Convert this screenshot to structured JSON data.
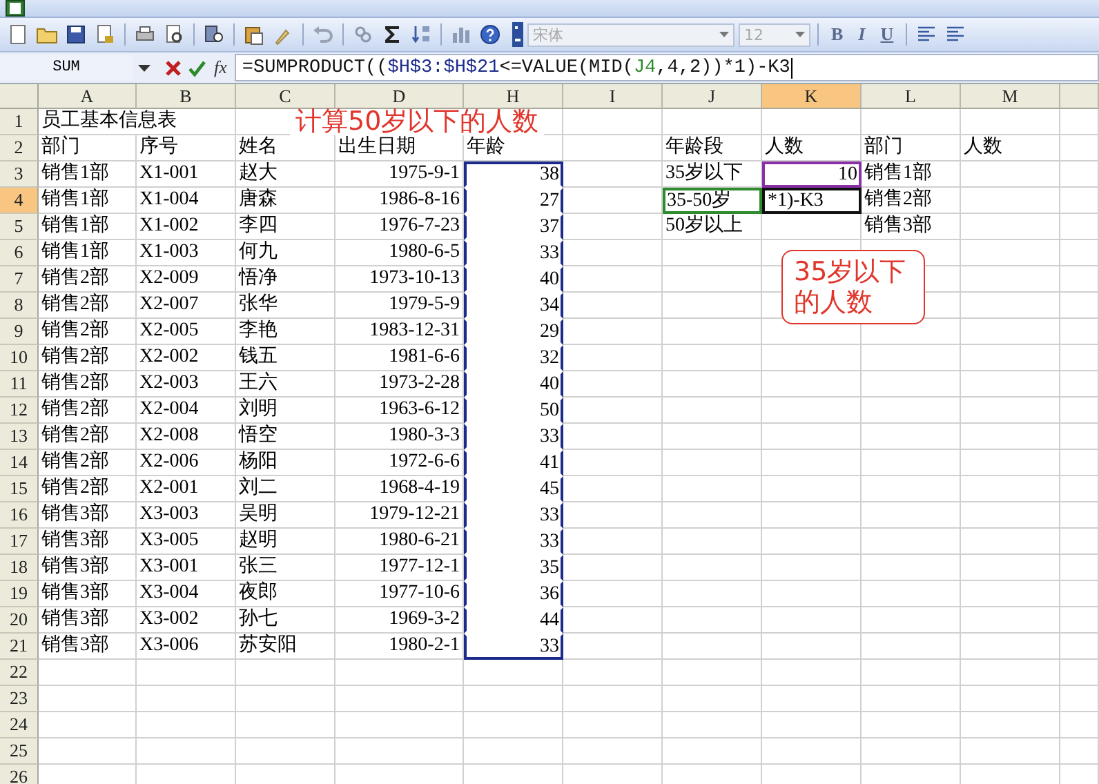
{
  "toolbar": {
    "font_name": {
      "value": "宋体",
      "disabled": true
    },
    "font_size": {
      "value": "12",
      "disabled": true
    },
    "format_buttons": [
      {
        "label": "B"
      },
      {
        "label": "I"
      },
      {
        "label": "U"
      }
    ]
  },
  "formula_bar": {
    "name_box": "SUM",
    "function_label": "fx",
    "parts": [
      {
        "kind": "plain",
        "text": "=SUMPRODUCT(("
      },
      {
        "kind": "range",
        "text": "$H$3:$H$21"
      },
      {
        "kind": "plain",
        "text": "<=VALUE(MID("
      },
      {
        "kind": "ref",
        "text": "J4"
      },
      {
        "kind": "plain",
        "text": ",4,2))*1)-K3"
      }
    ]
  },
  "sheet": {
    "columns": [
      {
        "label": "A",
        "selected": false
      },
      {
        "label": "B",
        "selected": false
      },
      {
        "label": "C",
        "selected": false
      },
      {
        "label": "D",
        "selected": false
      },
      {
        "label": "H",
        "selected": false
      },
      {
        "label": "I",
        "selected": false
      },
      {
        "label": "J",
        "selected": false
      },
      {
        "label": "K",
        "selected": true
      },
      {
        "label": "L",
        "selected": false
      },
      {
        "label": "M",
        "selected": false
      }
    ],
    "rows": [
      {
        "header": "1",
        "selected": false,
        "cells": [
          {
            "v": "员工基本信息表",
            "kind": "title"
          }
        ]
      },
      {
        "header": "2",
        "selected": false,
        "cells": [
          "部门",
          "序号",
          "姓名",
          "出生日期",
          "年龄",
          null,
          "年龄段",
          "人数",
          "部门",
          "人数"
        ]
      },
      {
        "header": "3",
        "selected": false,
        "cells": [
          "销售1部",
          "X1-001",
          "赵大",
          {
            "v": "1975-9-1",
            "kind": "number"
          },
          {
            "v": "38",
            "kind": "number",
            "color": "#1c2a8c"
          },
          null,
          "35岁以下",
          {
            "v": "10",
            "kind": "number",
            "color": "#8a2fa8"
          },
          "销售1部"
        ]
      },
      {
        "header": "4",
        "selected": true,
        "cells": [
          "销售1部",
          "X1-004",
          "唐森",
          {
            "v": "1986-8-16",
            "kind": "number"
          },
          {
            "v": "27",
            "kind": "number",
            "color": "#1c2a8c"
          },
          null,
          {
            "v": "35-50岁",
            "kind": "text",
            "color": "#2e8b2e"
          },
          {
            "v": "*1)-K3",
            "kind": "editing"
          },
          "销售2部"
        ]
      },
      {
        "header": "5",
        "selected": false,
        "cells": [
          "销售1部",
          "X1-002",
          "李四",
          {
            "v": "1976-7-23",
            "kind": "number"
          },
          {
            "v": "37",
            "kind": "number",
            "color": "#1c2a8c"
          },
          null,
          "50岁以上",
          null,
          "销售3部"
        ]
      },
      {
        "header": "6",
        "selected": false,
        "cells": [
          "销售1部",
          "X1-003",
          "何九",
          {
            "v": "1980-6-5",
            "kind": "number"
          },
          {
            "v": "33",
            "kind": "number",
            "color": "#1c2a8c"
          }
        ]
      },
      {
        "header": "7",
        "selected": false,
        "cells": [
          "销售2部",
          "X2-009",
          "悟净",
          {
            "v": "1973-10-13",
            "kind": "number"
          },
          {
            "v": "40",
            "kind": "number",
            "color": "#1c2a8c"
          }
        ]
      },
      {
        "header": "8",
        "selected": false,
        "cells": [
          "销售2部",
          "X2-007",
          "张华",
          {
            "v": "1979-5-9",
            "kind": "number"
          },
          {
            "v": "34",
            "kind": "number",
            "color": "#1c2a8c"
          }
        ]
      },
      {
        "header": "9",
        "selected": false,
        "cells": [
          "销售2部",
          "X2-005",
          "李艳",
          {
            "v": "1983-12-31",
            "kind": "number"
          },
          {
            "v": "29",
            "kind": "number",
            "color": "#1c2a8c"
          }
        ]
      },
      {
        "header": "10",
        "selected": false,
        "cells": [
          "销售2部",
          "X2-002",
          "钱五",
          {
            "v": "1981-6-6",
            "kind": "number"
          },
          {
            "v": "32",
            "kind": "number",
            "color": "#1c2a8c"
          }
        ]
      },
      {
        "header": "11",
        "selected": false,
        "cells": [
          "销售2部",
          "X2-003",
          "王六",
          {
            "v": "1973-2-28",
            "kind": "number"
          },
          {
            "v": "40",
            "kind": "number",
            "color": "#1c2a8c"
          }
        ]
      },
      {
        "header": "12",
        "selected": false,
        "cells": [
          "销售2部",
          "X2-004",
          "刘明",
          {
            "v": "1963-6-12",
            "kind": "number"
          },
          {
            "v": "50",
            "kind": "number",
            "color": "#1c2a8c"
          }
        ]
      },
      {
        "header": "13",
        "selected": false,
        "cells": [
          "销售2部",
          "X2-008",
          "悟空",
          {
            "v": "1980-3-3",
            "kind": "number"
          },
          {
            "v": "33",
            "kind": "number",
            "color": "#1c2a8c"
          }
        ]
      },
      {
        "header": "14",
        "selected": false,
        "cells": [
          "销售2部",
          "X2-006",
          "杨阳",
          {
            "v": "1972-6-6",
            "kind": "number"
          },
          {
            "v": "41",
            "kind": "number",
            "color": "#1c2a8c"
          }
        ]
      },
      {
        "header": "15",
        "selected": false,
        "cells": [
          "销售2部",
          "X2-001",
          "刘二",
          {
            "v": "1968-4-19",
            "kind": "number"
          },
          {
            "v": "45",
            "kind": "number",
            "color": "#1c2a8c"
          }
        ]
      },
      {
        "header": "16",
        "selected": false,
        "cells": [
          "销售3部",
          "X3-003",
          "吴明",
          {
            "v": "1979-12-21",
            "kind": "number"
          },
          {
            "v": "33",
            "kind": "number",
            "color": "#1c2a8c"
          }
        ]
      },
      {
        "header": "17",
        "selected": false,
        "cells": [
          "销售3部",
          "X3-005",
          "赵明",
          {
            "v": "1980-6-21",
            "kind": "number"
          },
          {
            "v": "33",
            "kind": "number",
            "color": "#1c2a8c"
          }
        ]
      },
      {
        "header": "18",
        "selected": false,
        "cells": [
          "销售3部",
          "X3-001",
          "张三",
          {
            "v": "1977-12-1",
            "kind": "number"
          },
          {
            "v": "35",
            "kind": "number",
            "color": "#1c2a8c"
          }
        ]
      },
      {
        "header": "19",
        "selected": false,
        "cells": [
          "销售3部",
          "X3-004",
          "夜郎",
          {
            "v": "1977-10-6",
            "kind": "number"
          },
          {
            "v": "36",
            "kind": "number",
            "color": "#1c2a8c"
          }
        ]
      },
      {
        "header": "20",
        "selected": false,
        "cells": [
          "销售3部",
          "X3-002",
          "孙七",
          {
            "v": "1969-3-2",
            "kind": "number"
          },
          {
            "v": "44",
            "kind": "number",
            "color": "#1c2a8c"
          }
        ]
      },
      {
        "header": "21",
        "selected": false,
        "cells": [
          "销售3部",
          "X3-006",
          "苏安阳",
          {
            "v": "1980-2-1",
            "kind": "number"
          },
          {
            "v": "33",
            "kind": "number",
            "color": "#1c2a8c"
          }
        ]
      },
      {
        "header": "22",
        "selected": false,
        "cells": []
      },
      {
        "header": "23",
        "selected": false,
        "cells": []
      },
      {
        "header": "24",
        "selected": false,
        "cells": []
      },
      {
        "header": "25",
        "selected": false,
        "cells": []
      },
      {
        "header": "26",
        "selected": false,
        "cells": []
      }
    ]
  },
  "annotations": [
    {
      "kind": "caption",
      "text": "计算50岁以下的人数"
    },
    {
      "kind": "callout",
      "text": "35岁以下的人数"
    }
  ]
}
